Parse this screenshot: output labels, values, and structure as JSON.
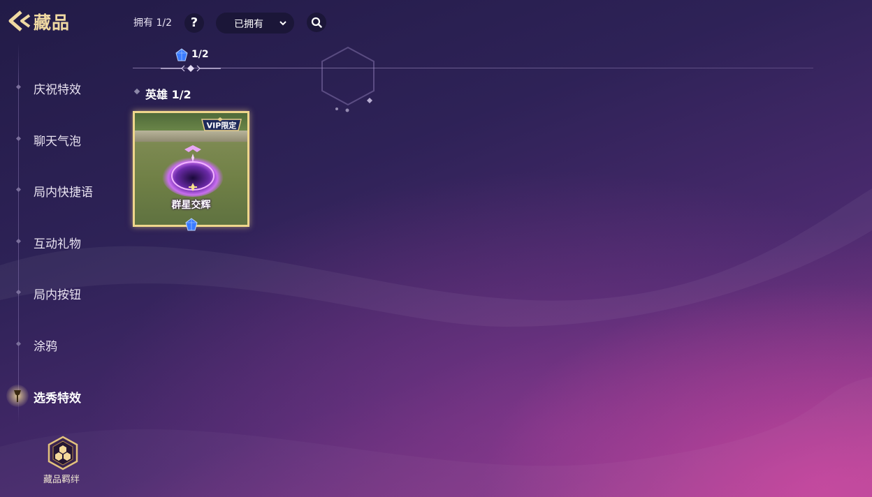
{
  "header": {
    "title": "藏品",
    "owned_label": "拥有 1/2",
    "help_label": "?",
    "filter": {
      "selected": "已拥有"
    }
  },
  "progress": {
    "gem_count": "1/2"
  },
  "section": {
    "title": "英雄  1/2"
  },
  "items": [
    {
      "name": "群星交辉",
      "badge": "VIP限定",
      "owned": true
    }
  ],
  "sidebar": {
    "items": [
      {
        "label": "庆祝特效",
        "active": false
      },
      {
        "label": "聊天气泡",
        "active": false
      },
      {
        "label": "局内快捷语",
        "active": false
      },
      {
        "label": "互动礼物",
        "active": false
      },
      {
        "label": "局内按钮",
        "active": false
      },
      {
        "label": "涂鸦",
        "active": false
      },
      {
        "label": "选秀特效",
        "active": true
      }
    ],
    "bond_label": "藏品羁绊"
  },
  "colors": {
    "title_gold": "#f0d9a2",
    "card_border": "#efd68c",
    "pill_bg": "#1b1638",
    "gem_blue": "#3a7bff"
  },
  "icons": [
    "back-arrow-icon",
    "help-icon",
    "chevron-down-icon",
    "search-icon",
    "gem-icon",
    "pin-icon",
    "hexagon-bond-icon"
  ]
}
